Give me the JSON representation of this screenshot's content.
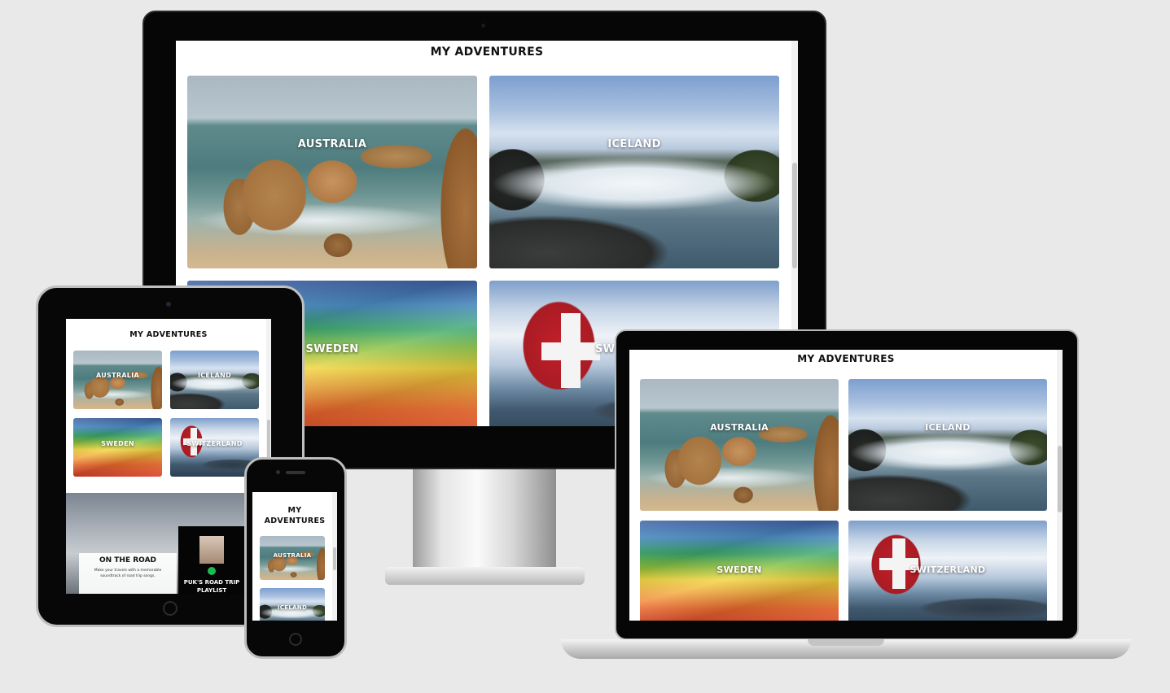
{
  "site": {
    "title": "MY ADVENTURES",
    "title_mobile_line1": "MY",
    "title_mobile_line2": "ADVENTURES"
  },
  "tiles": [
    {
      "label": "AUSTRALIA",
      "scene": "australia"
    },
    {
      "label": "ICELAND",
      "scene": "iceland"
    },
    {
      "label": "SWEDEN",
      "scene": "sweden"
    },
    {
      "label": "SWITZERLAND",
      "scene": "switzerland"
    }
  ],
  "desktop_partial_label": "SW",
  "on_the_road": {
    "title": "ON THE ROAD",
    "description": "Make your travels with a memorable soundtrack of road trip songs.",
    "playlist_title": "PUK'S ROAD TRIP PLAYLIST",
    "spotify_icon": "spotify-icon"
  },
  "colors": {
    "background": "#e9e9e9",
    "bezel": "#060606",
    "spotify_green": "#1db954",
    "flag_red": "#c2202a"
  }
}
